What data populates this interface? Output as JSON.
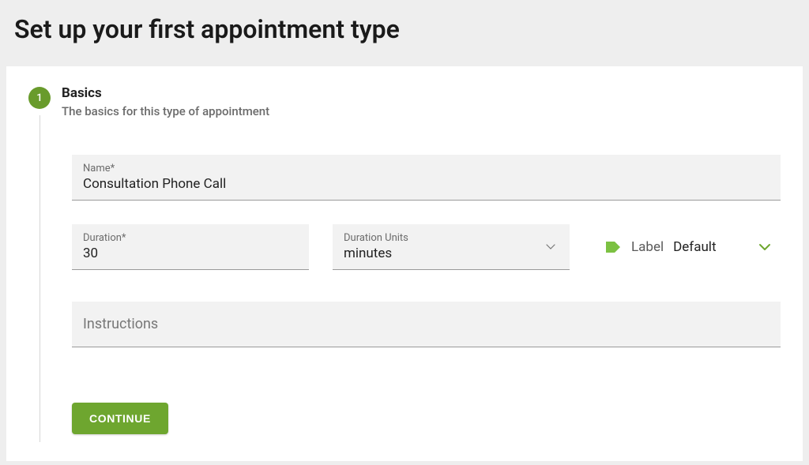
{
  "page": {
    "title": "Set up your first appointment type"
  },
  "step": {
    "number": "1",
    "title": "Basics",
    "subtitle": "The basics for this type of appointment"
  },
  "form": {
    "name": {
      "label": "Name*",
      "value": "Consultation Phone Call"
    },
    "duration": {
      "label": "Duration*",
      "value": "30"
    },
    "duration_units": {
      "label": "Duration Units",
      "value": "minutes"
    },
    "label_select": {
      "label": "Label",
      "value": "Default"
    },
    "instructions": {
      "placeholder": "Instructions",
      "value": ""
    }
  },
  "buttons": {
    "continue": "CONTINUE"
  }
}
